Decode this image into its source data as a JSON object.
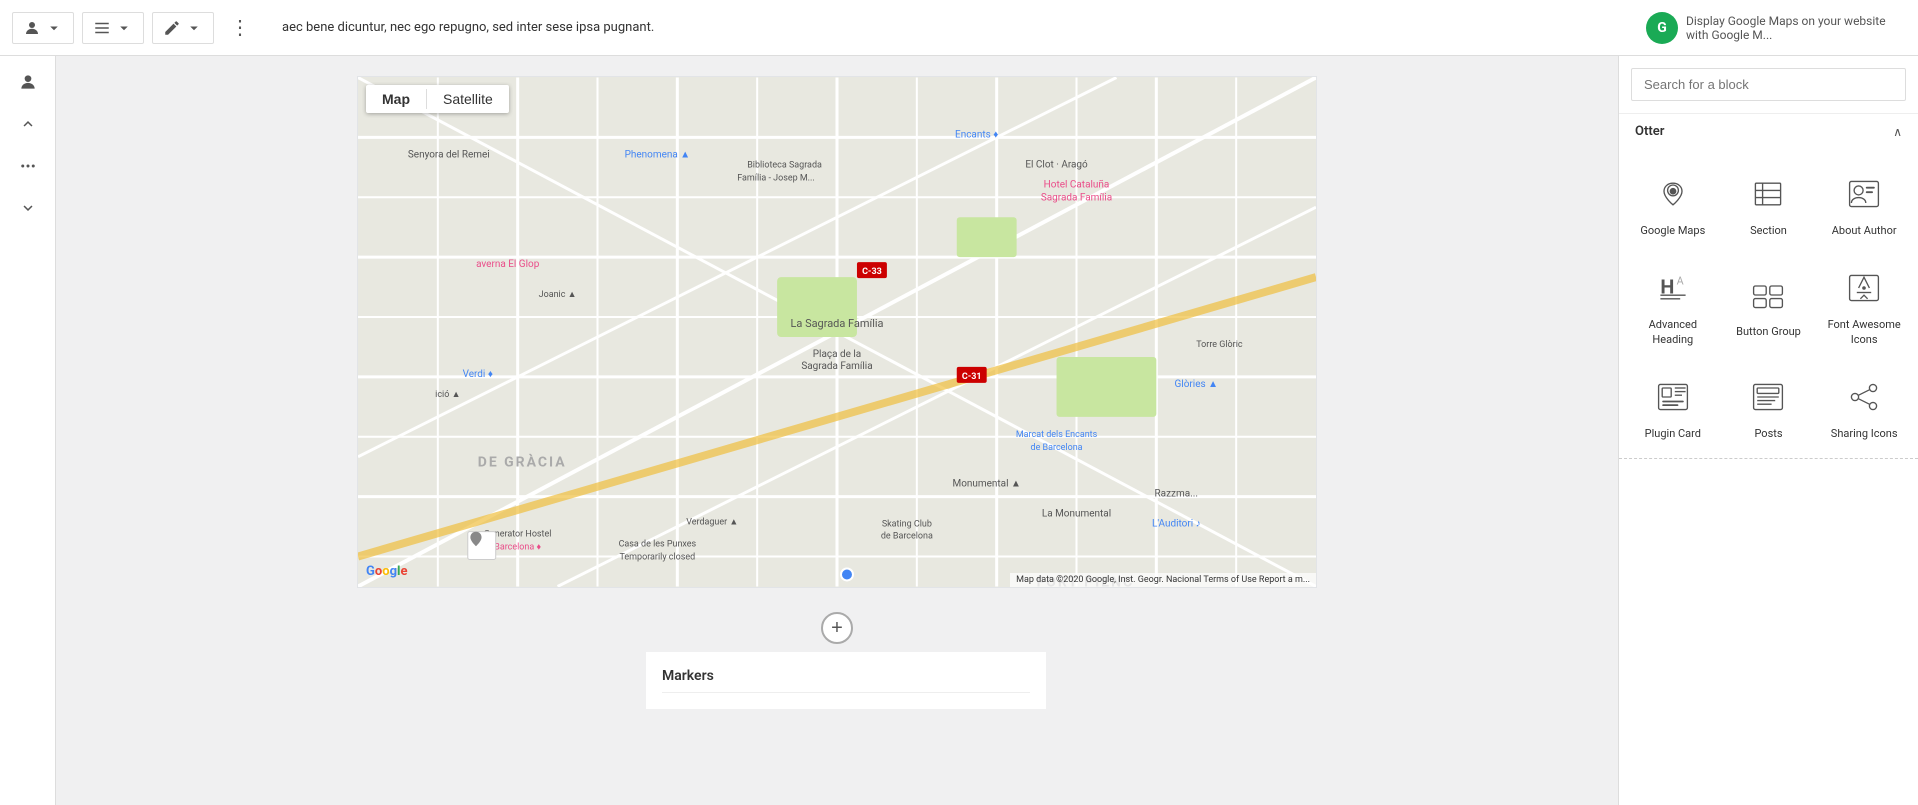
{
  "toolbar": {
    "kebab_label": "⋮",
    "text_content": "aec bene dicuntur, nec ego repugno, sed inter sese ipsa pugnant.",
    "circle_initial": "G",
    "desc_text": "Display Google Maps on your website with Google M..."
  },
  "left_sidebar": {
    "icons": [
      {
        "name": "person-icon",
        "glyph": "👤"
      },
      {
        "name": "list-icon",
        "glyph": "☰"
      },
      {
        "name": "pen-icon",
        "glyph": "✏"
      },
      {
        "name": "arrow-up-icon",
        "glyph": "▲"
      },
      {
        "name": "arrow-down-icon",
        "glyph": "▼"
      }
    ]
  },
  "map": {
    "map_btn": "Map",
    "satellite_btn": "Satellite",
    "attribution": "Map data ©2020 Google, Inst. Geogr. Nacional  Terms of Use  Report a m...",
    "google_logo": "Google"
  },
  "right_panel": {
    "search_placeholder": "Search for a block",
    "section_title": "Otter",
    "blocks": [
      {
        "id": "google-maps",
        "label": "Google Maps",
        "icon": "map-pin"
      },
      {
        "id": "section",
        "label": "Section",
        "icon": "section"
      },
      {
        "id": "about-author",
        "label": "About Author",
        "icon": "about-author"
      },
      {
        "id": "advanced-heading",
        "label": "Advanced Heading",
        "icon": "advanced-heading"
      },
      {
        "id": "button-group",
        "label": "Button Group",
        "icon": "button-group"
      },
      {
        "id": "font-awesome-icons",
        "label": "Font Awesome Icons",
        "icon": "font-awesome"
      },
      {
        "id": "plugin-card",
        "label": "Plugin Card",
        "icon": "plugin-card"
      },
      {
        "id": "posts",
        "label": "Posts",
        "icon": "posts"
      },
      {
        "id": "sharing-icons",
        "label": "Sharing Icons",
        "icon": "sharing-icons"
      }
    ],
    "chevron": "∧"
  },
  "bottom": {
    "markers_label": "Markers"
  }
}
